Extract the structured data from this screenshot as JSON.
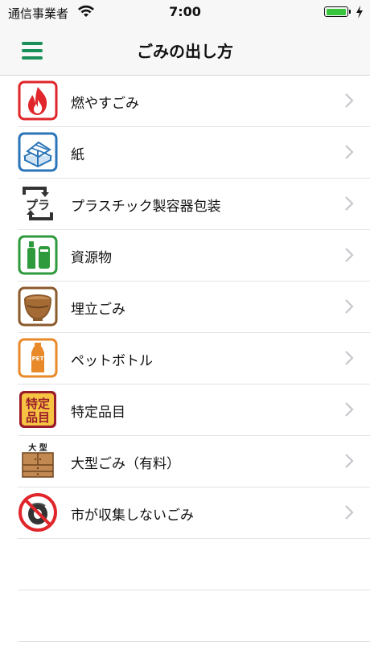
{
  "status_bar": {
    "carrier": "通信事業者",
    "time": "7:00"
  },
  "nav": {
    "title": "ごみの出し方",
    "menu_icon": "hamburger-icon",
    "accent_color": "#1a8f5a"
  },
  "items": [
    {
      "label": "燃やすごみ",
      "icon": "fire-icon",
      "color": "#e0262b"
    },
    {
      "label": "紙",
      "icon": "paper-bundle-icon",
      "color": "#2a74b8"
    },
    {
      "label": "プラスチック製容器包装",
      "icon": "plastic-recycle-icon",
      "color": "#333333"
    },
    {
      "label": "資源物",
      "icon": "bottle-can-icon",
      "color": "#2f9a3c"
    },
    {
      "label": "埋立ごみ",
      "icon": "ceramic-bowl-icon",
      "color": "#8b5a2b"
    },
    {
      "label": "ペットボトル",
      "icon": "pet-bottle-icon",
      "color": "#e8892a"
    },
    {
      "label": "特定品目",
      "icon": "specified-items-icon",
      "color": "#9a1c2b"
    },
    {
      "label": "大型ごみ（有料）",
      "icon": "oversized-cabinet-icon",
      "color": "#a46b35",
      "icon_text": "大 型"
    },
    {
      "label": "市が収集しないごみ",
      "icon": "no-tire-icon",
      "color": "#e0262b"
    }
  ],
  "icon_text": {
    "plastic": "プラ",
    "pet": "PET",
    "specified_line1": "特定",
    "specified_line2": "品目",
    "oversized": "大 型"
  }
}
